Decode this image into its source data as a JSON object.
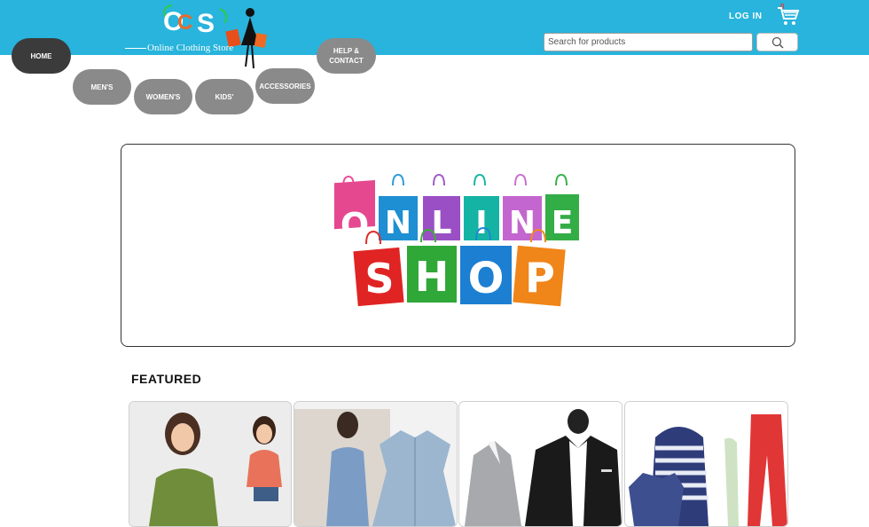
{
  "header": {
    "logo_tagline": "Online Clothing Store",
    "logo_letters": [
      "O",
      "C",
      "S"
    ],
    "login_label": "LOG IN",
    "cart_count": "0",
    "search_placeholder": "Search for products",
    "bar_color": "#28b4dc"
  },
  "nav": {
    "home": "HOME",
    "mens": "MEN'S",
    "womens": "WOMEN'S",
    "kids": "KIDS'",
    "accessories": "ACCESSORIES",
    "help_line1": "HELP &",
    "help_line2": "CONTACT"
  },
  "banner": {
    "row1": [
      "O",
      "N",
      "L",
      "I",
      "N",
      "E"
    ],
    "row2": [
      "S",
      "H",
      "O",
      "P"
    ]
  },
  "featured": {
    "heading": "FEATURED",
    "products": [
      {
        "icon": "women-tops-photo"
      },
      {
        "icon": "denim-dress-photo"
      },
      {
        "icon": "mens-blazers-photo"
      },
      {
        "icon": "casual-wear-photo"
      }
    ]
  },
  "colors": {
    "nav_gray": "#8a8a8a",
    "nav_active": "#3b3b3b"
  }
}
